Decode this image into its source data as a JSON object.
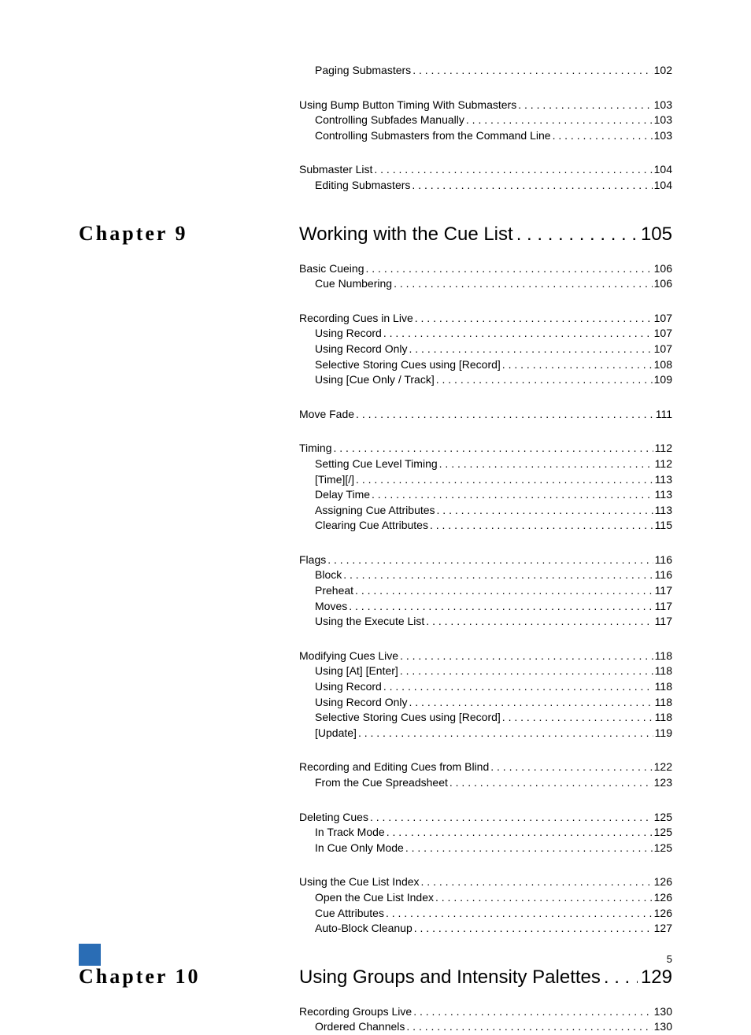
{
  "pre_sections": [
    {
      "rows": [
        {
          "level": 2,
          "label": "Paging Submasters",
          "page": "102"
        }
      ]
    },
    {
      "rows": [
        {
          "level": 1,
          "label": "Using Bump Button Timing With Submasters",
          "page": "103"
        },
        {
          "level": 2,
          "label": "Controlling Subfades Manually",
          "page": "103"
        },
        {
          "level": 2,
          "label": "Controlling Submasters from the Command Line",
          "page": "103"
        }
      ]
    },
    {
      "rows": [
        {
          "level": 1,
          "label": "Submaster List",
          "page": "104"
        },
        {
          "level": 2,
          "label": "Editing Submasters",
          "page": "104"
        }
      ]
    }
  ],
  "chapters": [
    {
      "chapter_label": "Chapter 9",
      "title": "Working with the Cue List",
      "page": "105",
      "sections": [
        {
          "rows": [
            {
              "level": 1,
              "label": "Basic Cueing",
              "page": "106"
            },
            {
              "level": 2,
              "label": "Cue Numbering",
              "page": "106"
            }
          ]
        },
        {
          "rows": [
            {
              "level": 1,
              "label": "Recording Cues in Live",
              "page": "107"
            },
            {
              "level": 2,
              "label": "Using Record",
              "page": "107"
            },
            {
              "level": 2,
              "label": "Using Record Only",
              "page": "107"
            },
            {
              "level": 2,
              "label": "Selective Storing Cues using [Record]",
              "page": "108"
            },
            {
              "level": 2,
              "label": "Using [Cue Only / Track]",
              "page": "109"
            }
          ]
        },
        {
          "rows": [
            {
              "level": 1,
              "label": "Move Fade",
              "page": "111"
            }
          ]
        },
        {
          "rows": [
            {
              "level": 1,
              "label": "Timing",
              "page": "112"
            },
            {
              "level": 2,
              "label": "Setting Cue Level Timing",
              "page": "112"
            },
            {
              "level": 2,
              "label": "[Time][/]",
              "page": "113"
            },
            {
              "level": 2,
              "label": "Delay Time",
              "page": "113"
            },
            {
              "level": 2,
              "label": "Assigning Cue Attributes",
              "page": "113"
            },
            {
              "level": 2,
              "label": "Clearing Cue Attributes",
              "page": "115"
            }
          ]
        },
        {
          "rows": [
            {
              "level": 1,
              "label": "Flags",
              "page": "116"
            },
            {
              "level": 2,
              "label": "Block",
              "page": "116"
            },
            {
              "level": 2,
              "label": "Preheat",
              "page": "117"
            },
            {
              "level": 2,
              "label": "Moves",
              "page": "117"
            },
            {
              "level": 2,
              "label": "Using the Execute List",
              "page": "117"
            }
          ]
        },
        {
          "rows": [
            {
              "level": 1,
              "label": "Modifying Cues Live",
              "page": "118"
            },
            {
              "level": 2,
              "label": "Using [At] [Enter]",
              "page": "118"
            },
            {
              "level": 2,
              "label": "Using Record",
              "page": "118"
            },
            {
              "level": 2,
              "label": "Using Record Only",
              "page": "118"
            },
            {
              "level": 2,
              "label": "Selective Storing Cues using [Record]",
              "page": "118"
            },
            {
              "level": 2,
              "label": "[Update]",
              "page": "119"
            }
          ]
        },
        {
          "rows": [
            {
              "level": 1,
              "label": "Recording and Editing Cues from Blind",
              "page": "122"
            },
            {
              "level": 2,
              "label": "From the Cue Spreadsheet",
              "page": "123"
            }
          ]
        },
        {
          "rows": [
            {
              "level": 1,
              "label": "Deleting Cues",
              "page": "125"
            },
            {
              "level": 2,
              "label": "In Track Mode",
              "page": "125"
            },
            {
              "level": 2,
              "label": "In Cue Only Mode",
              "page": "125"
            }
          ]
        },
        {
          "rows": [
            {
              "level": 1,
              "label": "Using the Cue List Index",
              "page": "126"
            },
            {
              "level": 2,
              "label": "Open the Cue List Index",
              "page": "126"
            },
            {
              "level": 2,
              "label": "Cue Attributes",
              "page": "126"
            },
            {
              "level": 2,
              "label": "Auto-Block Cleanup",
              "page": "127"
            }
          ]
        }
      ]
    },
    {
      "chapter_label": "Chapter 10",
      "title": "Using Groups and Intensity Palettes",
      "page": "129",
      "sections": [
        {
          "rows": [
            {
              "level": 1,
              "label": "Recording Groups Live",
              "page": "130"
            },
            {
              "level": 2,
              "label": "Ordered Channels",
              "page": "130"
            }
          ]
        }
      ]
    }
  ],
  "footer_page": "5"
}
